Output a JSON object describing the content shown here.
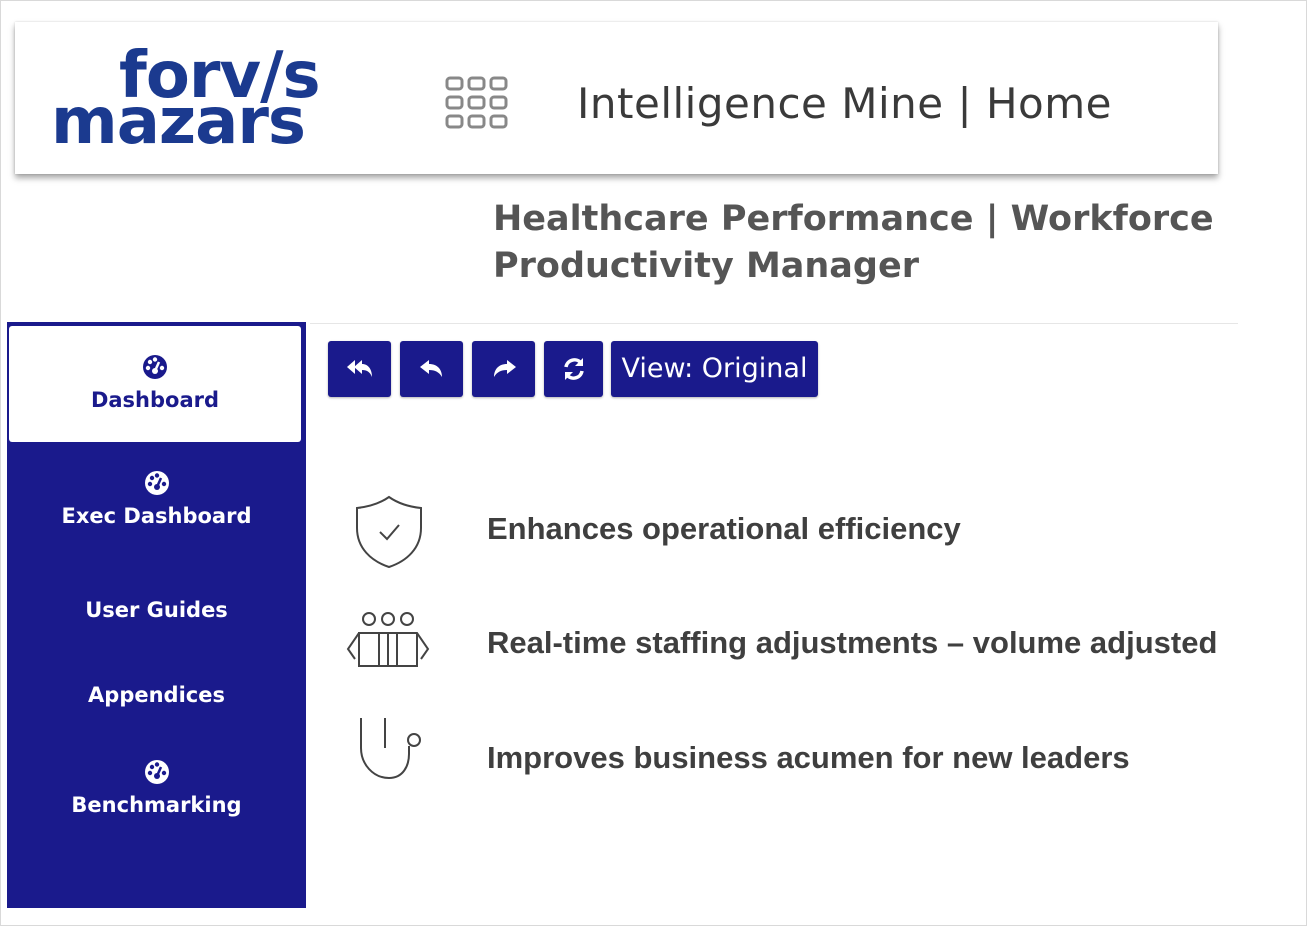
{
  "header": {
    "logo_line1": "forv/s",
    "logo_line2": "mazars",
    "app_title": "Intelligence Mine | Home"
  },
  "subtitle": {
    "line1": "Healthcare Performance | Workforce",
    "line2": "Productivity Manager"
  },
  "sidebar": {
    "items": [
      {
        "label": "Dashboard",
        "icon": "dashboard-gauge-icon",
        "active": true
      },
      {
        "label": "Exec Dashboard",
        "icon": "dashboard-gauge-icon",
        "active": false
      },
      {
        "label": "User Guides",
        "icon": "",
        "active": false
      },
      {
        "label": "Appendices",
        "icon": "",
        "active": false
      },
      {
        "label": "Benchmarking",
        "icon": "dashboard-gauge-icon",
        "active": false
      }
    ]
  },
  "toolbar": {
    "buttons": [
      {
        "name": "reset-undo-all",
        "icon": "reply-all-icon"
      },
      {
        "name": "undo",
        "icon": "undo-icon"
      },
      {
        "name": "redo",
        "icon": "redo-icon"
      },
      {
        "name": "refresh",
        "icon": "refresh-icon"
      }
    ],
    "view_label": "View: Original"
  },
  "features": [
    {
      "icon": "shield-check-icon",
      "text": "Enhances operational efficiency"
    },
    {
      "icon": "people-group-icon",
      "text": "Real-time staffing adjustments – volume adjusted"
    },
    {
      "icon": "stethoscope-icon",
      "text": "Improves business acumen for new leaders"
    }
  ],
  "colors": {
    "brand_blue": "#1b3a8f",
    "sidebar_navy": "#1a1a8c",
    "text_gray": "#3f3f3f"
  }
}
